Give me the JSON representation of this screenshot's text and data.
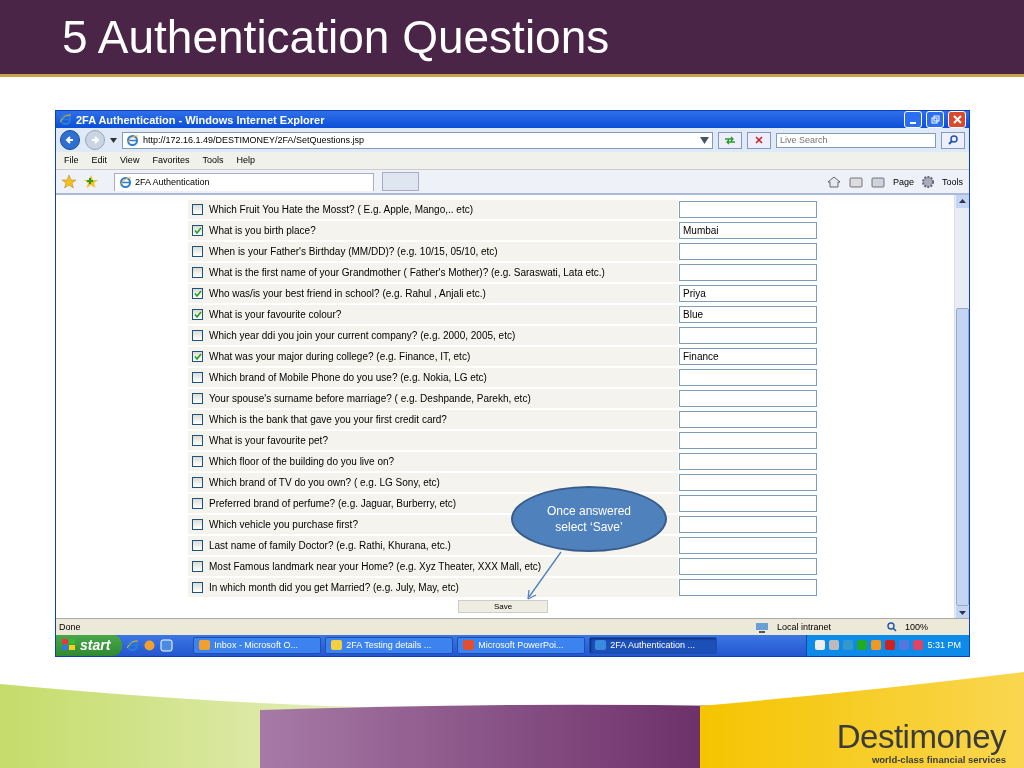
{
  "slide": {
    "title": "5 Authentication Questions"
  },
  "browser": {
    "title": "2FA Authentication - Windows Internet Explorer",
    "address": "http://172.16.1.49/DESTIMONEY/2FA/SetQuestions.jsp",
    "search_placeholder": "Live Search",
    "menu": [
      "File",
      "Edit",
      "View",
      "Favorites",
      "Tools",
      "Help"
    ],
    "tab": "2FA Authentication",
    "toolbar": [
      "Page",
      "Tools"
    ]
  },
  "questions": [
    {
      "text": "Which Fruit You Hate the Mosst? ( E.g. Apple, Mango,.. etc)",
      "checked": false
    },
    {
      "text": "What is you birth place?",
      "checked": true,
      "answer": "Mumbai"
    },
    {
      "text": "When is your Father's Birthday (MM/DD)? (e.g. 10/15, 05/10, etc)",
      "checked": false
    },
    {
      "text": "What is the first name of your Grandmother ( Father's Mother)? (e.g. Saraswati, Lata etc.)",
      "checked": false
    },
    {
      "text": "Who was/is your best friend in school? (e.g. Rahul , Anjali etc.)",
      "checked": true,
      "answer": "Priya"
    },
    {
      "text": "What is your favourite colour?",
      "checked": true,
      "answer": "Blue"
    },
    {
      "text": "Which year ddi you join your current company? (e.g. 2000, 2005, etc)",
      "checked": false
    },
    {
      "text": "What was your major during college? (e.g. Finance, IT, etc)",
      "checked": true,
      "answer": "Finance"
    },
    {
      "text": "Which brand of Mobile Phone do you use? (e.g. Nokia, LG etc)",
      "checked": false
    },
    {
      "text": "Your spouse's surname before marriage? ( e.g. Deshpande, Parekh, etc)",
      "checked": false
    },
    {
      "text": "Which is the bank that gave you your first credit card?",
      "checked": false
    },
    {
      "text": "What is your favourite pet?",
      "checked": false
    },
    {
      "text": "Which floor of the building do you live on?",
      "checked": false
    },
    {
      "text": "Which brand of TV do you own? ( e.g. LG Sony, etc)",
      "checked": false
    },
    {
      "text": "Preferred brand of perfume? (e.g. Jaguar, Burberry, etc)",
      "checked": false
    },
    {
      "text": "Which vehicle you purchase first?",
      "checked": false
    },
    {
      "text": "Last name of family Doctor? (e.g. Rathi, Khurana, etc.)",
      "checked": false
    },
    {
      "text": "Most Famous landmark near your Home? (e.g. Xyz Theater, XXX Mall, etc)",
      "checked": false
    },
    {
      "text": "In which month did you get Married? (e.g. July, May, etc)",
      "checked": false
    }
  ],
  "save": "Save",
  "callout": "Once answered select ‘Save’",
  "status": {
    "text": "Done",
    "zone": "Local intranet",
    "zoom": "100%"
  },
  "taskbar": {
    "start": "start",
    "items": [
      {
        "label": "Inbox - Microsoft O...",
        "selected": false
      },
      {
        "label": "2FA Testing details ...",
        "selected": false
      },
      {
        "label": "Microsoft PowerPoi...",
        "selected": false
      },
      {
        "label": "2FA Authentication ...",
        "selected": true
      }
    ],
    "clock": "5:31 PM"
  },
  "logo": {
    "name": "Destimoney",
    "tagline": "world-class financial services"
  }
}
